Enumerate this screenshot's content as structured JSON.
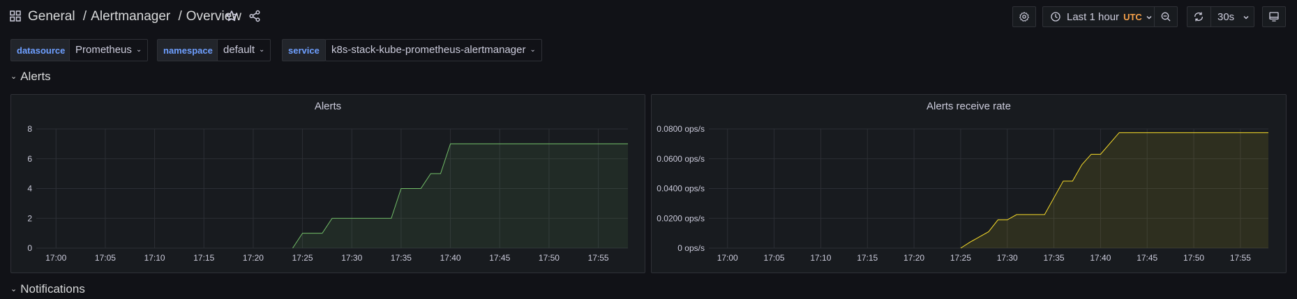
{
  "header": {
    "breadcrumb": [
      "General",
      "Alertmanager",
      "Overview"
    ],
    "separator": "/",
    "time_range": "Last 1 hour",
    "timezone": "UTC",
    "refresh_interval": "30s"
  },
  "variables": [
    {
      "label": "datasource",
      "value": "Prometheus"
    },
    {
      "label": "namespace",
      "value": "default"
    },
    {
      "label": "service",
      "value": "k8s-stack-kube-prometheus-alertmanager"
    }
  ],
  "rows": [
    {
      "title": "Alerts"
    },
    {
      "title": "Notifications"
    }
  ],
  "colors": {
    "background": "#111217",
    "panel": "#181b1f",
    "series_green": "#73bf69",
    "series_yellow": "#fade2a",
    "utc": "#f5a04a",
    "variable_label": "#6e9fff"
  },
  "chart_data": [
    {
      "type": "area",
      "title": "Alerts",
      "x_ticks": [
        "17:00",
        "17:05",
        "17:10",
        "17:15",
        "17:20",
        "17:25",
        "17:30",
        "17:35",
        "17:40",
        "17:45",
        "17:50",
        "17:55"
      ],
      "y_ticks": [
        "0",
        "2",
        "4",
        "6",
        "8"
      ],
      "ylim": [
        0,
        8
      ],
      "xlim": [
        "16:58",
        "17:58"
      ],
      "grid": true,
      "series": [
        {
          "color": "#73bf69",
          "points": [
            [
              "17:24",
              0
            ],
            [
              "17:25",
              1
            ],
            [
              "17:27",
              1
            ],
            [
              "17:28",
              2
            ],
            [
              "17:30",
              2
            ],
            [
              "17:34",
              2
            ],
            [
              "17:35",
              4
            ],
            [
              "17:37",
              4
            ],
            [
              "17:38",
              5
            ],
            [
              "17:39",
              5
            ],
            [
              "17:40",
              7
            ],
            [
              "17:58",
              7
            ]
          ]
        }
      ]
    },
    {
      "type": "area",
      "title": "Alerts receive rate",
      "x_ticks": [
        "17:00",
        "17:05",
        "17:10",
        "17:15",
        "17:20",
        "17:25",
        "17:30",
        "17:35",
        "17:40",
        "17:45",
        "17:50",
        "17:55"
      ],
      "y_ticks": [
        "0 ops/s",
        "0.0200 ops/s",
        "0.0400 ops/s",
        "0.0600 ops/s",
        "0.0800 ops/s"
      ],
      "ylim": [
        0,
        0.08
      ],
      "xlim": [
        "16:58",
        "17:58"
      ],
      "grid": true,
      "series": [
        {
          "color": "#fade2a",
          "points": [
            [
              "17:25",
              0
            ],
            [
              "17:26",
              0.004
            ],
            [
              "17:28",
              0.011
            ],
            [
              "17:29",
              0.019
            ],
            [
              "17:30",
              0.019
            ],
            [
              "17:31",
              0.0225
            ],
            [
              "17:34",
              0.0225
            ],
            [
              "17:36",
              0.045
            ],
            [
              "17:37",
              0.045
            ],
            [
              "17:38",
              0.056
            ],
            [
              "17:39",
              0.063
            ],
            [
              "17:40",
              0.063
            ],
            [
              "17:42",
              0.0775
            ],
            [
              "17:58",
              0.0775
            ]
          ]
        }
      ]
    }
  ]
}
